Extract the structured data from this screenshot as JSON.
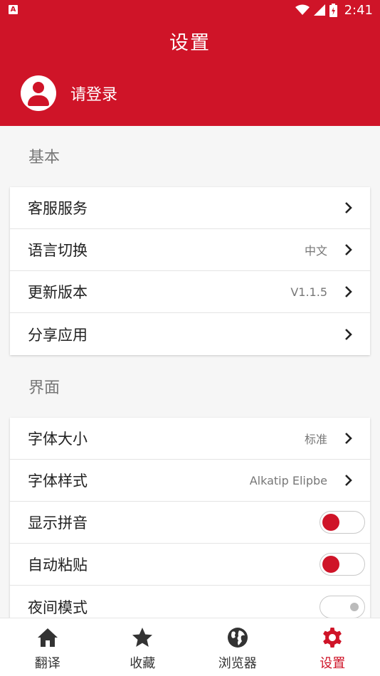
{
  "status_bar": {
    "app_icon": "A",
    "time": "2:41",
    "icons": [
      "wifi-icon",
      "signal-icon",
      "battery-icon"
    ]
  },
  "header": {
    "title": "设置",
    "login_label": "请登录"
  },
  "sections": {
    "basic": {
      "title": "基本",
      "items": [
        {
          "label": "客服服务",
          "value": ""
        },
        {
          "label": "语言切换",
          "value": "中文"
        },
        {
          "label": "更新版本",
          "value": "V1.1.5"
        },
        {
          "label": "分享应用",
          "value": ""
        }
      ]
    },
    "interface": {
      "title": "界面",
      "items": [
        {
          "label": "字体大小",
          "value": "标准"
        },
        {
          "label": "字体样式",
          "value": "Alkatip Elipbe"
        },
        {
          "label": "显示拼音",
          "toggle": true
        },
        {
          "label": "自动粘贴",
          "toggle": true
        },
        {
          "label": "夜间模式",
          "toggle": false
        }
      ]
    }
  },
  "bottom_nav": {
    "items": [
      {
        "label": "翻译",
        "icon": "home-icon",
        "active": false
      },
      {
        "label": "收藏",
        "icon": "star-icon",
        "active": false
      },
      {
        "label": "浏览器",
        "icon": "globe-icon",
        "active": false
      },
      {
        "label": "设置",
        "icon": "gear-icon",
        "active": true
      }
    ]
  },
  "colors": {
    "accent": "#cf1428",
    "background": "#f6f6f6"
  }
}
